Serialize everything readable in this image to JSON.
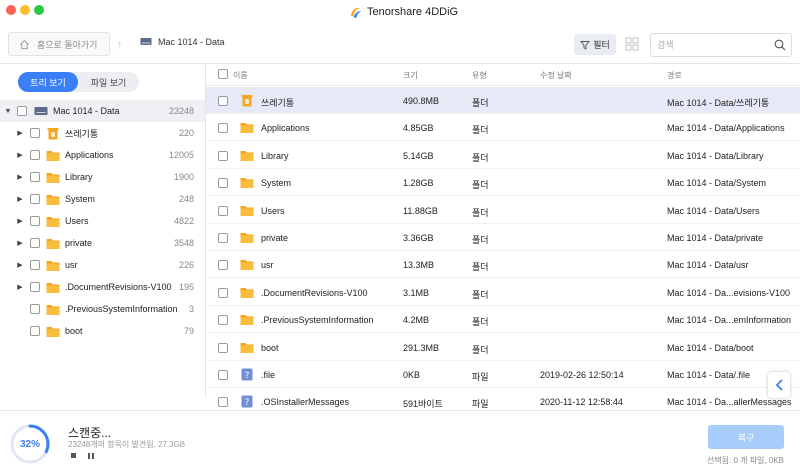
{
  "window": {
    "title": "Tenorshare 4DDiG"
  },
  "toolbar": {
    "home_label": "홈으로 돌아가기",
    "disk_label": "Mac 1014 - Data",
    "filter_label": "필터",
    "search_placeholder": "검색"
  },
  "sidebar": {
    "tab_tree": "트리 보기",
    "tab_file": "파일 보기",
    "root": {
      "label": "Mac 1014 - Data",
      "count": "23248"
    },
    "items": [
      {
        "label": "쓰레기통",
        "count": "220",
        "icon": "trash-icon",
        "caret": true
      },
      {
        "label": "Applications",
        "count": "12005",
        "icon": "folder-icon",
        "caret": true
      },
      {
        "label": "Library",
        "count": "1900",
        "icon": "folder-icon",
        "caret": true
      },
      {
        "label": "System",
        "count": "248",
        "icon": "folder-icon",
        "caret": true
      },
      {
        "label": "Users",
        "count": "4822",
        "icon": "folder-icon",
        "caret": true
      },
      {
        "label": "private",
        "count": "3548",
        "icon": "folder-icon",
        "caret": true
      },
      {
        "label": "usr",
        "count": "226",
        "icon": "folder-icon",
        "caret": true
      },
      {
        "label": ".DocumentRevisions-V100",
        "count": "195",
        "icon": "folder-icon",
        "caret": true
      },
      {
        "label": ".PreviousSystemInformation",
        "count": "3",
        "icon": "folder-icon",
        "caret": false
      },
      {
        "label": "boot",
        "count": "79",
        "icon": "folder-icon",
        "caret": false
      }
    ]
  },
  "list": {
    "headers": {
      "name": "이름",
      "size": "크기",
      "type": "유형",
      "modified": "수정 날짜",
      "path": "경로"
    },
    "rows": [
      {
        "name": "쓰레기통",
        "size": "490.8MB",
        "type": "폴더",
        "date": "",
        "path": "Mac 1014 - Data/쓰레기통",
        "icon": "trash-icon"
      },
      {
        "name": "Applications",
        "size": "4.85GB",
        "type": "폴더",
        "date": "",
        "path": "Mac 1014 - Data/Applications",
        "icon": "folder-icon"
      },
      {
        "name": "Library",
        "size": "5.14GB",
        "type": "폴더",
        "date": "",
        "path": "Mac 1014 - Data/Library",
        "icon": "folder-icon"
      },
      {
        "name": "System",
        "size": "1.28GB",
        "type": "폴더",
        "date": "",
        "path": "Mac 1014 - Data/System",
        "icon": "folder-icon"
      },
      {
        "name": "Users",
        "size": "11.88GB",
        "type": "폴더",
        "date": "",
        "path": "Mac 1014 - Data/Users",
        "icon": "folder-icon"
      },
      {
        "name": "private",
        "size": "3.36GB",
        "type": "폴더",
        "date": "",
        "path": "Mac 1014 - Data/private",
        "icon": "folder-icon"
      },
      {
        "name": "usr",
        "size": "13.3MB",
        "type": "폴더",
        "date": "",
        "path": "Mac 1014 - Data/usr",
        "icon": "folder-icon"
      },
      {
        "name": ".DocumentRevisions-V100",
        "size": "3.1MB",
        "type": "폴더",
        "date": "",
        "path": "Mac 1014 - Da...evisions-V100",
        "icon": "folder-icon"
      },
      {
        "name": ".PreviousSystemInformation",
        "size": "4.2MB",
        "type": "폴더",
        "date": "",
        "path": "Mac 1014 - Da...emInformation",
        "icon": "folder-icon"
      },
      {
        "name": "boot",
        "size": "291.3MB",
        "type": "폴더",
        "date": "",
        "path": "Mac 1014 - Data/boot",
        "icon": "folder-icon"
      },
      {
        "name": ".file",
        "size": "0KB",
        "type": "파일",
        "date": "2019-02-26 12:50:14",
        "path": "Mac 1014 - Data/.file",
        "icon": "unknown-file-icon"
      },
      {
        "name": ".OSInstallerMessages",
        "size": "591바이트",
        "type": "파일",
        "date": "2020-11-12 12:58:44",
        "path": "Mac 1014 - Da...allerMessages",
        "icon": "unknown-file-icon"
      }
    ]
  },
  "status": {
    "progress": "32%",
    "progress_value": 0.32,
    "title": "스캔중...",
    "subtitle": "23248개의 항목이 발견됨, 27.3GB",
    "recover_label": "복구",
    "selection_info": "선택됨: 0 개 파일, 0KB"
  },
  "colors": {
    "accent": "#3a7ff6",
    "folder": "#f5a623",
    "selected_row": "#e6eaf7",
    "recover_disabled": "#a9cdfb"
  }
}
